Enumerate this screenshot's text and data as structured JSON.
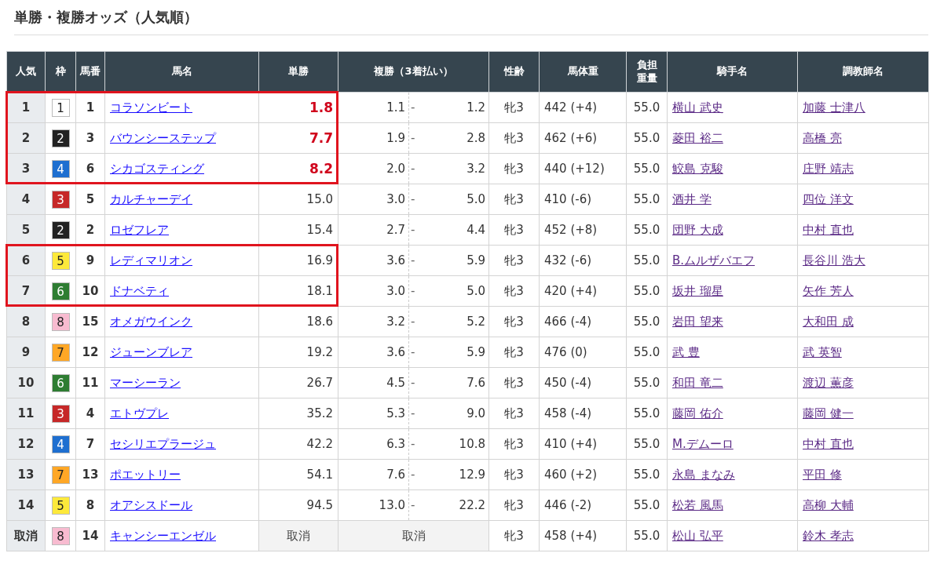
{
  "title": "単勝・複勝オッズ（人気順）",
  "columns": [
    "人気",
    "枠",
    "馬番",
    "馬名",
    "単勝",
    "複勝（3着払い）",
    "性齢",
    "馬体重",
    "負担重量",
    "騎手名",
    "調教師名"
  ],
  "rows": [
    {
      "kind": "normal",
      "highlighted": true,
      "emphasized": true,
      "rank": "1",
      "frame": {
        "number": "1",
        "color": "#ffffff"
      },
      "number": "1",
      "horse": "コラソンビート",
      "win": "1.8",
      "place": {
        "low": "1.1",
        "sep": "-",
        "high": "1.2"
      },
      "sex_age": "牝3",
      "weight": "442 (+4)",
      "burden": "55.0",
      "jockey": "横山 武史",
      "trainer": "加藤 士津八"
    },
    {
      "kind": "normal",
      "highlighted": true,
      "emphasized": true,
      "rank": "2",
      "frame": {
        "number": "2",
        "color": "#222222"
      },
      "number": "3",
      "horse": "バウンシーステップ",
      "win": "7.7",
      "place": {
        "low": "1.9",
        "sep": "-",
        "high": "2.8"
      },
      "sex_age": "牝3",
      "weight": "462 (+6)",
      "burden": "55.0",
      "jockey": "菱田 裕二",
      "trainer": "高橋 亮"
    },
    {
      "kind": "normal",
      "highlighted": true,
      "emphasized": true,
      "rank": "3",
      "frame": {
        "number": "4",
        "color": "#1e6fd0"
      },
      "number": "6",
      "horse": "シカゴスティング",
      "win": "8.2",
      "place": {
        "low": "2.0",
        "sep": "-",
        "high": "3.2"
      },
      "sex_age": "牝3",
      "weight": "440 (+12)",
      "burden": "55.0",
      "jockey": "鮫島 克駿",
      "trainer": "庄野 靖志"
    },
    {
      "kind": "normal",
      "highlighted": false,
      "emphasized": false,
      "rank": "4",
      "frame": {
        "number": "3",
        "color": "#c62828"
      },
      "number": "5",
      "horse": "カルチャーデイ",
      "win": "15.0",
      "place": {
        "low": "3.0",
        "sep": "-",
        "high": "5.0"
      },
      "sex_age": "牝3",
      "weight": "410 (-6)",
      "burden": "55.0",
      "jockey": "酒井 学",
      "trainer": "四位 洋文"
    },
    {
      "kind": "normal",
      "highlighted": false,
      "emphasized": false,
      "rank": "5",
      "frame": {
        "number": "2",
        "color": "#222222"
      },
      "number": "2",
      "horse": "ロゼフレア",
      "win": "15.4",
      "place": {
        "low": "2.7",
        "sep": "-",
        "high": "4.4"
      },
      "sex_age": "牝3",
      "weight": "452 (+8)",
      "burden": "55.0",
      "jockey": "団野 大成",
      "trainer": "中村 直也"
    },
    {
      "kind": "normal",
      "highlighted": true,
      "emphasized": false,
      "rank": "6",
      "frame": {
        "number": "5",
        "color": "#fde93b"
      },
      "number": "9",
      "horse": "レディマリオン",
      "win": "16.9",
      "place": {
        "low": "3.6",
        "sep": "-",
        "high": "5.9"
      },
      "sex_age": "牝3",
      "weight": "432 (-6)",
      "burden": "55.0",
      "jockey": "B.ムルザバエフ",
      "trainer": "長谷川 浩大"
    },
    {
      "kind": "normal",
      "highlighted": true,
      "emphasized": false,
      "rank": "7",
      "frame": {
        "number": "6",
        "color": "#2e7d32"
      },
      "number": "10",
      "horse": "ドナベティ",
      "win": "18.1",
      "place": {
        "low": "3.0",
        "sep": "-",
        "high": "5.0"
      },
      "sex_age": "牝3",
      "weight": "420 (+4)",
      "burden": "55.0",
      "jockey": "坂井 瑠星",
      "trainer": "矢作 芳人"
    },
    {
      "kind": "normal",
      "highlighted": false,
      "emphasized": false,
      "rank": "8",
      "frame": {
        "number": "8",
        "color": "#f8bbd0"
      },
      "number": "15",
      "horse": "オメガウインク",
      "win": "18.6",
      "place": {
        "low": "3.2",
        "sep": "-",
        "high": "5.2"
      },
      "sex_age": "牝3",
      "weight": "466 (-4)",
      "burden": "55.0",
      "jockey": "岩田 望来",
      "trainer": "大和田 成"
    },
    {
      "kind": "normal",
      "highlighted": false,
      "emphasized": false,
      "rank": "9",
      "frame": {
        "number": "7",
        "color": "#ffa726"
      },
      "number": "12",
      "horse": "ジューンブレア",
      "win": "19.2",
      "place": {
        "low": "3.6",
        "sep": "-",
        "high": "5.9"
      },
      "sex_age": "牝3",
      "weight": "476 (0)",
      "burden": "55.0",
      "jockey": "武 豊",
      "trainer": "武 英智"
    },
    {
      "kind": "normal",
      "highlighted": false,
      "emphasized": false,
      "rank": "10",
      "frame": {
        "number": "6",
        "color": "#2e7d32"
      },
      "number": "11",
      "horse": "マーシーラン",
      "win": "26.7",
      "place": {
        "low": "4.5",
        "sep": "-",
        "high": "7.6"
      },
      "sex_age": "牝3",
      "weight": "450 (-4)",
      "burden": "55.0",
      "jockey": "和田 竜二",
      "trainer": "渡辺 薫彦"
    },
    {
      "kind": "normal",
      "highlighted": false,
      "emphasized": false,
      "rank": "11",
      "frame": {
        "number": "3",
        "color": "#c62828"
      },
      "number": "4",
      "horse": "エトヴプレ",
      "win": "35.2",
      "place": {
        "low": "5.3",
        "sep": "-",
        "high": "9.0"
      },
      "sex_age": "牝3",
      "weight": "458 (-4)",
      "burden": "55.0",
      "jockey": "藤岡 佑介",
      "trainer": "藤岡 健一"
    },
    {
      "kind": "normal",
      "highlighted": false,
      "emphasized": false,
      "rank": "12",
      "frame": {
        "number": "4",
        "color": "#1e6fd0"
      },
      "number": "7",
      "horse": "セシリエプラージュ",
      "win": "42.2",
      "place": {
        "low": "6.3",
        "sep": "-",
        "high": "10.8"
      },
      "sex_age": "牝3",
      "weight": "410 (+4)",
      "burden": "55.0",
      "jockey": "M.デムーロ",
      "trainer": "中村 直也"
    },
    {
      "kind": "normal",
      "highlighted": false,
      "emphasized": false,
      "rank": "13",
      "frame": {
        "number": "7",
        "color": "#ffa726"
      },
      "number": "13",
      "horse": "ポエットリー",
      "win": "54.1",
      "place": {
        "low": "7.6",
        "sep": "-",
        "high": "12.9"
      },
      "sex_age": "牝3",
      "weight": "460 (+2)",
      "burden": "55.0",
      "jockey": "永島 まなみ",
      "trainer": "平田 修"
    },
    {
      "kind": "normal",
      "highlighted": false,
      "emphasized": false,
      "rank": "14",
      "frame": {
        "number": "5",
        "color": "#fde93b"
      },
      "number": "8",
      "horse": "オアシスドール",
      "win": "94.5",
      "place": {
        "low": "13.0",
        "sep": "-",
        "high": "22.2"
      },
      "sex_age": "牝3",
      "weight": "446 (-2)",
      "burden": "55.0",
      "jockey": "松若 風馬",
      "trainer": "高柳 大輔"
    },
    {
      "kind": "scratched",
      "highlighted": false,
      "rank": "取消",
      "frame": {
        "number": "8",
        "color": "#f8bbd0"
      },
      "number": "14",
      "horse": "キャンシーエンゼル",
      "win": "取消",
      "place": {
        "text": "取消"
      },
      "sex_age": "牝3",
      "weight": "458 (+4)",
      "burden": "55.0",
      "jockey": "松山 弘平",
      "trainer": "鈴木 孝志"
    }
  ]
}
